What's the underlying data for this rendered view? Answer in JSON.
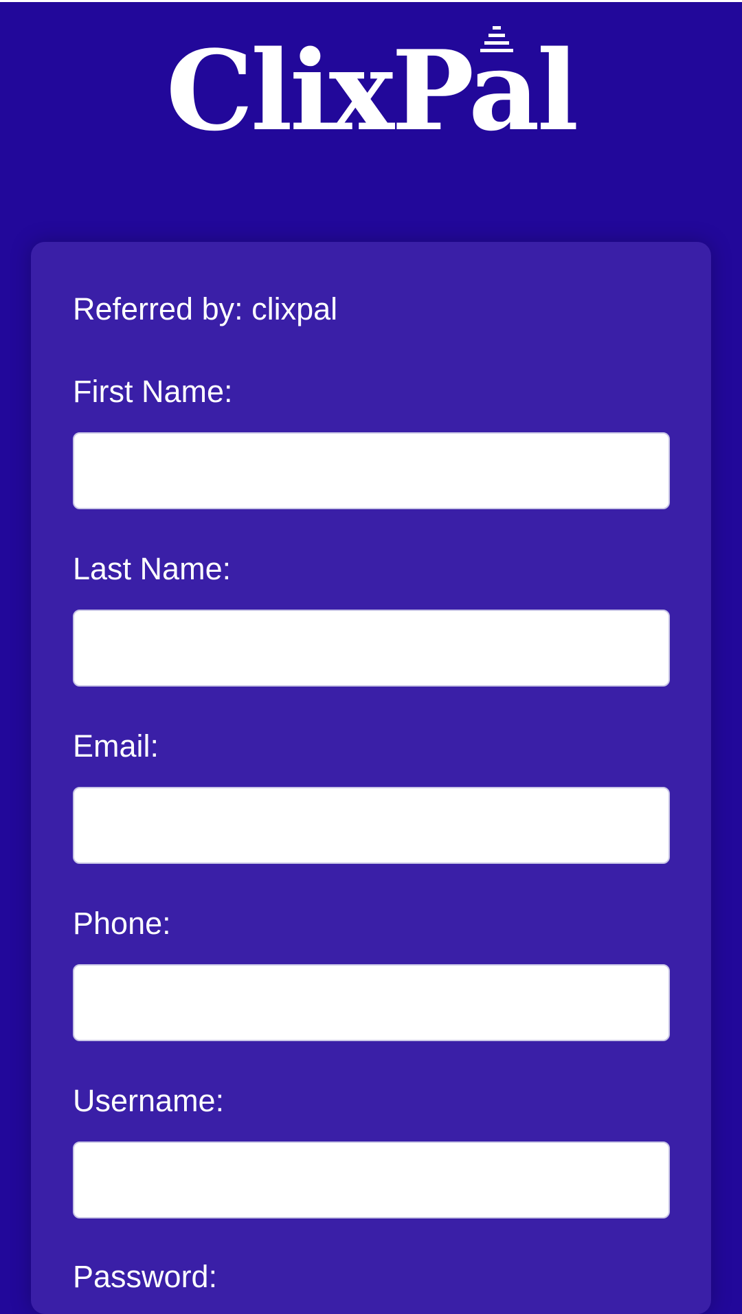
{
  "brand": {
    "logo_text": "ClixPal"
  },
  "form": {
    "referred_by": "Referred by: clixpal",
    "fields": [
      {
        "label": "First Name:",
        "value": "",
        "placeholder": ""
      },
      {
        "label": "Last Name:",
        "value": "",
        "placeholder": ""
      },
      {
        "label": "Email:",
        "value": "",
        "placeholder": ""
      },
      {
        "label": "Phone:",
        "value": "",
        "placeholder": ""
      },
      {
        "label": "Username:",
        "value": "",
        "placeholder": ""
      },
      {
        "label": "Password:",
        "value": "",
        "placeholder": ""
      }
    ]
  },
  "colors": {
    "background": "#22089a",
    "card": "#3a1fa7",
    "text": "#ffffff",
    "input_background": "#ffffff"
  }
}
